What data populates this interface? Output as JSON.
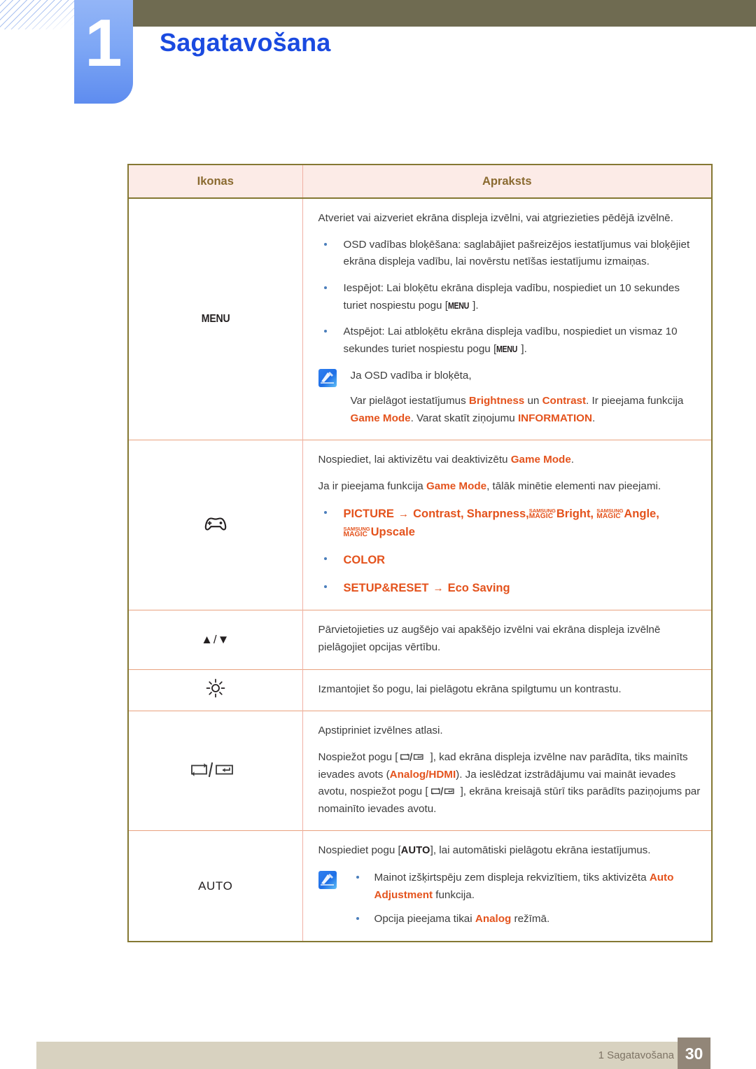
{
  "chapter": {
    "number": "1",
    "title": "Sagatavošana"
  },
  "table": {
    "headers": {
      "icons": "Ikonas",
      "description": "Apraksts"
    },
    "rows": [
      {
        "icon_name": "menu-button-label",
        "icon_label": "MENU",
        "paragraphs": [
          "Atveriet vai aizveriet ekrāna displeja izvēlni, vai atgriezieties pēdējā izvēlnē."
        ],
        "bullets": [
          "OSD vadības bloķēšana: saglabājiet pašreizējos iestatījumus vai bloķējiet ekrāna displeja vadību, lai novērstu netīšas iestatījumu izmaiņas.",
          "Iespējot: Lai bloķētu ekrāna displeja vadību, nospiediet un 10 sekundes turiet nospiestu pogu [MENU].",
          "Atspējot: Lai atbloķētu ekrāna displeja vadību, nospiediet un vismaz 10 sekundes turiet nospiestu pogu [MENU]."
        ],
        "bullet2_pre": "Iespējot: Lai bloķētu ekrāna displeja vadību, nospiediet un 10 sekundes turiet nospiestu pogu [",
        "bullet2_key": "MENU",
        "bullet2_post": "].",
        "bullet3_pre": "Atspējot: Lai atbloķētu ekrāna displeja vadību, nospiediet un vismaz 10 sekundes turiet nospiestu pogu [",
        "bullet3_key": "MENU",
        "bullet3_post": "].",
        "note": {
          "line1": "Ja OSD vadība ir bloķēta,",
          "l2_a": "Var pielāgot iestatījumus ",
          "l2_b": "Brightness",
          "l2_c": " un ",
          "l2_d": "Contrast",
          "l2_e": ". Ir pieejama funkcija ",
          "l2_f": "Game Mode",
          "l2_g": ". Varat skatīt ziņojumu ",
          "l2_h": "INFORMATION",
          "l2_i": "."
        }
      },
      {
        "icon_name": "gamepad-icon",
        "p1_a": "Nospiediet, lai aktivizētu vai deaktivizētu ",
        "p1_b": "Game Mode",
        "p1_c": ".",
        "p2_a": "Ja ir pieejama funkcija ",
        "p2_b": "Game Mode",
        "p2_c": ", tālāk minētie elementi nav pieejami.",
        "menu_bullets": {
          "picture": "PICTURE",
          "arrow": "→",
          "contrast": "Contrast,",
          "sharpness": "Sharpness,",
          "magic_s": "SAMSUNG",
          "magic_m": "MAGIC",
          "bright": "Bright,",
          "angle": "Angle,",
          "upscale": "Upscale",
          "color": "COLOR",
          "setupreset": "SETUP&RESET",
          "ecosaving": "Eco Saving"
        }
      },
      {
        "icon_name": "up-down-arrows-icon",
        "icon_label": "▲/▼",
        "text": "Pārvietojieties uz augšējo vai apakšējo izvēlni vai ekrāna displeja izvēlnē pielāgojiet opcijas vērtību."
      },
      {
        "icon_name": "brightness-sun-icon",
        "text": "Izmantojiet šo pogu, lai pielāgotu ekrāna spilgtumu un kontrastu."
      },
      {
        "icon_name": "source-enter-icon",
        "p1": "Apstipriniet izvēlnes atlasi.",
        "p2_a": "Nospiežot pogu [",
        "p2_b": "], kad ekrāna displeja izvēlne nav parādīta, tiks mainīts ievades avots (",
        "p2_analog": "Analog",
        "p2_slash": "/",
        "p2_hdmi": "HDMI",
        "p2_c": "). Ja ieslēdzat izstrādājumu vai maināt ievades avotu, nospiežot pogu [",
        "p2_d": "], ekrāna kreisajā stūrī tiks parādīts paziņojums par nomainīto ievades avotu."
      },
      {
        "icon_name": "auto-button-label",
        "icon_label": "AUTO",
        "p1_a": "Nospiediet pogu [",
        "p1_key": "AUTO",
        "p1_b": "], lai automātiski pielāgotu ekrāna iestatījumus.",
        "note_bullet1_a": "Mainot izšķirtspēju zem displeja rekvizītiem, tiks aktivizēta ",
        "note_bullet1_b": "Auto Adjustment",
        "note_bullet1_c": " funkcija.",
        "note_bullet2_a": "Opcija pieejama tikai ",
        "note_bullet2_b": "Analog",
        "note_bullet2_c": " režīmā."
      }
    ]
  },
  "footer": {
    "text": "1 Sagatavošana",
    "page": "30"
  },
  "colors": {
    "accent_orange": "#e4531d",
    "chapter_blue": "#1a4ae0",
    "band_olive": "#6f6b51",
    "table_border": "#857833",
    "row_separator": "#e9a27f",
    "header_bg": "#fcebe7",
    "footer_bar": "#d8d2c0",
    "page_box": "#928678"
  }
}
